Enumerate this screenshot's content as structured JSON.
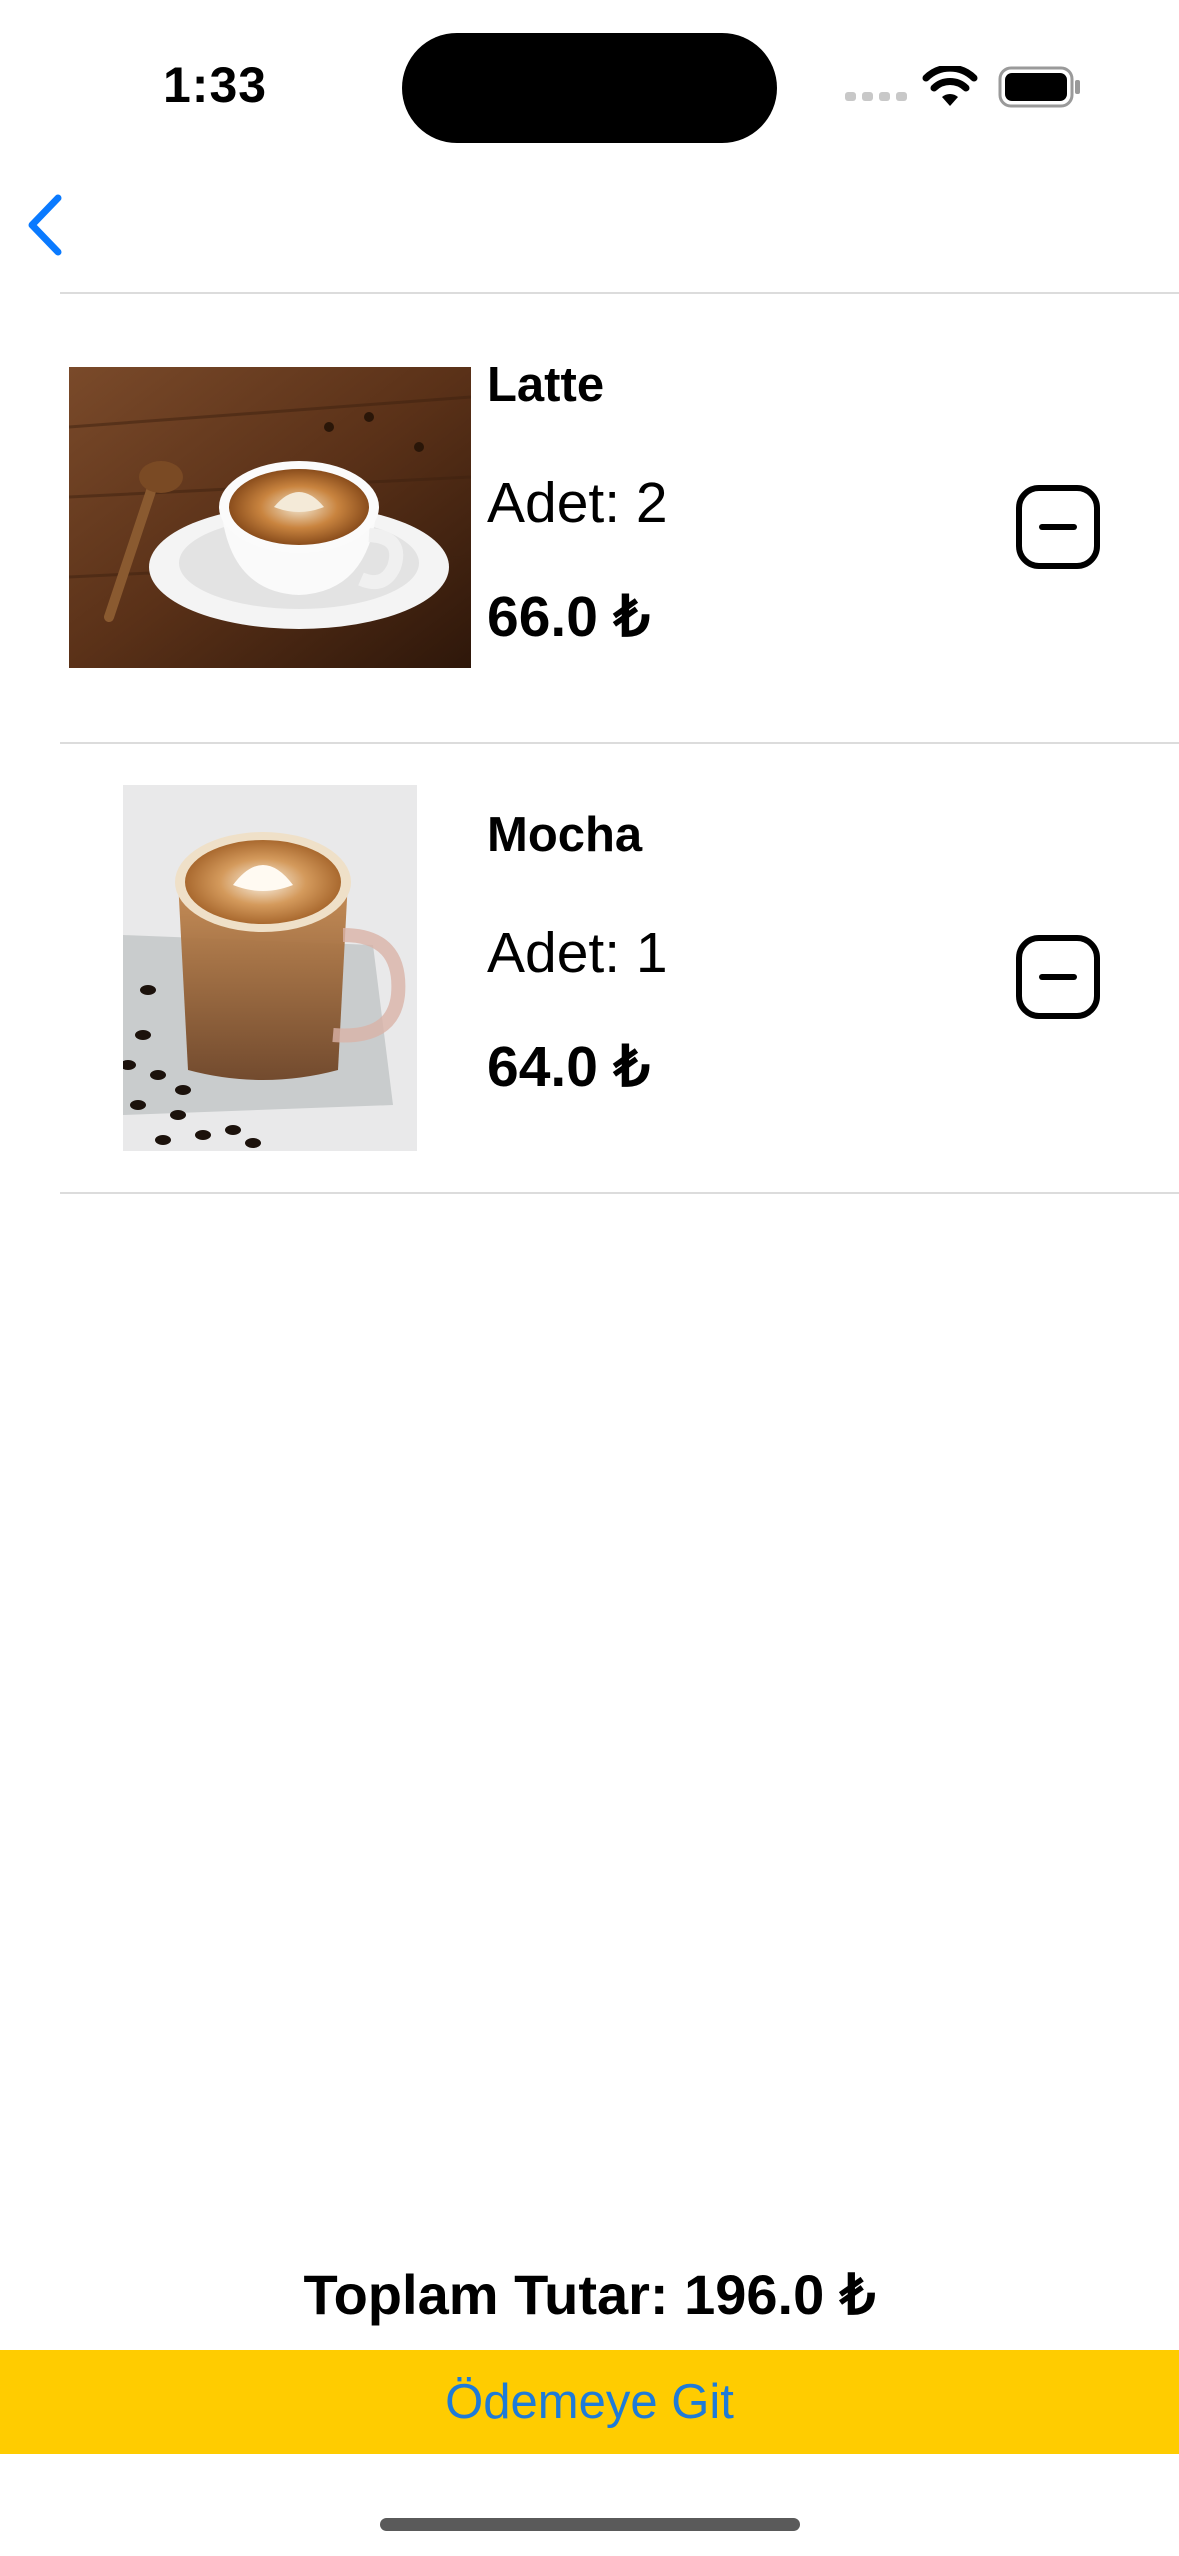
{
  "status_bar": {
    "time": "1:33",
    "icons": [
      "signal-dots-icon",
      "wifi-icon",
      "battery-icon"
    ]
  },
  "nav": {
    "back_icon": "chevron-left-icon"
  },
  "cart": {
    "items": [
      {
        "name": "Latte",
        "quantity": "Adet: 2",
        "price": "66.0 ₺",
        "image": "latte-photo",
        "remove_icon": "minus-square-icon"
      },
      {
        "name": "Mocha",
        "quantity": "Adet: 1",
        "price": "64.0 ₺",
        "image": "mocha-photo",
        "remove_icon": "minus-square-icon"
      }
    ]
  },
  "footer": {
    "total": "Toplam Tutar: 196.0 ₺",
    "checkout_label": "Ödemeye Git"
  },
  "colors": {
    "accent": "#0A7AFF",
    "checkout_bg": "#FFCC00",
    "checkout_text": "#1E7BD8",
    "divider": "#DCDCDC"
  }
}
